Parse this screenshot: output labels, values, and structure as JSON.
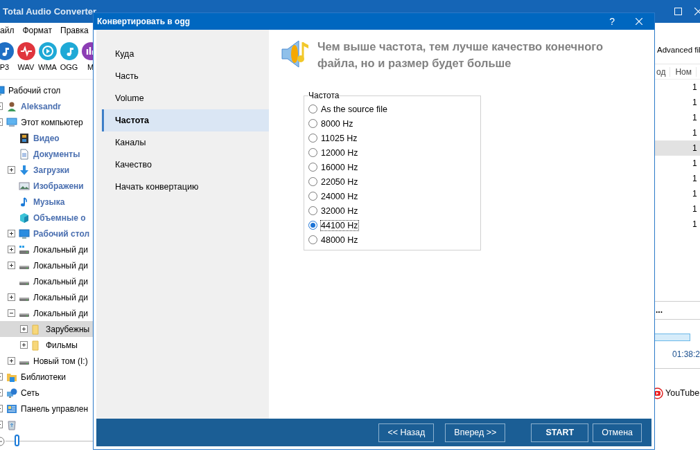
{
  "app": {
    "title": "Total Audio Converter",
    "menu": [
      "айл",
      "Формат",
      "Правка"
    ],
    "formats": [
      {
        "label": "P3",
        "color": "#1f6fc4",
        "kind": "note"
      },
      {
        "label": "WAV",
        "color": "#e0353d",
        "kind": "wave"
      },
      {
        "label": "WMA",
        "color": "#1fa9d6",
        "kind": "play"
      },
      {
        "label": "OGG",
        "color": "#1fa9d6",
        "kind": "note"
      },
      {
        "label": "M",
        "color": "#8c3db4",
        "kind": "bars"
      }
    ],
    "tree": [
      {
        "label": "Рабочий стол",
        "kind": "desktop",
        "bold": false,
        "selected": false,
        "expandable": false,
        "children": [
          {
            "label": "Aleksandr",
            "kind": "user",
            "bold": true,
            "selected": false,
            "expandable": true
          },
          {
            "label": "Этот компьютер",
            "kind": "computer",
            "bold": false,
            "selected": false,
            "expandable": true,
            "children": [
              {
                "label": "Видео",
                "kind": "video",
                "bold": true,
                "selected": false,
                "expandable": false
              },
              {
                "label": "Документы",
                "kind": "document",
                "bold": true,
                "selected": false,
                "expandable": false
              },
              {
                "label": "Загрузки",
                "kind": "download",
                "bold": true,
                "selected": false,
                "expandable": true,
                "expanded": false
              },
              {
                "label": "Изображени",
                "kind": "image",
                "bold": true,
                "selected": false,
                "expandable": false
              },
              {
                "label": "Музыка",
                "kind": "music",
                "bold": true,
                "selected": false,
                "expandable": false
              },
              {
                "label": "Объемные о",
                "kind": "cube",
                "bold": true,
                "selected": false,
                "expandable": false
              },
              {
                "label": "Рабочий стол",
                "kind": "desktop",
                "bold": true,
                "selected": false,
                "expandable": true,
                "expanded": false
              },
              {
                "label": "Локальный ди",
                "kind": "drive-win",
                "bold": false,
                "selected": false,
                "expandable": true,
                "expanded": false
              },
              {
                "label": "Локальный ди",
                "kind": "drive",
                "bold": false,
                "selected": false,
                "expandable": true,
                "expanded": false
              },
              {
                "label": "Локальный ди",
                "kind": "drive",
                "bold": false,
                "selected": false,
                "expandable": false
              },
              {
                "label": "Локальный ди",
                "kind": "drive",
                "bold": false,
                "selected": false,
                "expandable": true,
                "expanded": false
              },
              {
                "label": "Локальный ди",
                "kind": "drive",
                "bold": false,
                "selected": false,
                "expandable": true,
                "expanded": true,
                "children": [
                  {
                    "label": "Зарубежны",
                    "kind": "folder",
                    "bold": false,
                    "selected": true,
                    "expandable": true,
                    "expanded": false
                  },
                  {
                    "label": "Фильмы",
                    "kind": "folder",
                    "bold": false,
                    "selected": false,
                    "expandable": true,
                    "expanded": false
                  }
                ]
              },
              {
                "label": "Новый том (I:)",
                "kind": "drive",
                "bold": false,
                "selected": false,
                "expandable": true,
                "expanded": false
              }
            ]
          },
          {
            "label": "Библиотеки",
            "kind": "library",
            "bold": false,
            "selected": false,
            "expandable": true
          },
          {
            "label": "Сеть",
            "kind": "network",
            "bold": false,
            "selected": false,
            "expandable": true
          },
          {
            "label": "Панель управлен",
            "kind": "panel",
            "bold": false,
            "selected": false,
            "expandable": true
          },
          {
            "kind": "recycle",
            "bold": false,
            "selected": false,
            "expandable": true
          }
        ]
      }
    ],
    "right_panel": {
      "filter": "Advanced fil",
      "columns": [
        "од",
        "Ном"
      ],
      "rows": [
        {
          "value": "1",
          "selected": false
        },
        {
          "value": "1",
          "selected": false
        },
        {
          "value": "1",
          "selected": false
        },
        {
          "value": "1",
          "selected": false
        },
        {
          "value": "1",
          "selected": true
        },
        {
          "value": "1",
          "selected": false
        },
        {
          "value": "1",
          "selected": false
        },
        {
          "value": "1",
          "selected": false
        },
        {
          "value": "1",
          "selected": false
        },
        {
          "value": "1",
          "selected": false
        }
      ],
      "ellipsis": "...",
      "progress": {
        "level": 1
      },
      "time": "01:38:2",
      "youtube": "YouTube"
    }
  },
  "dialog": {
    "title": "Конвертировать в ogg",
    "help": "?",
    "nav": [
      {
        "label": "Куда",
        "selected": false
      },
      {
        "label": "Часть",
        "selected": false
      },
      {
        "label": "Volume",
        "selected": false
      },
      {
        "label": "Частота",
        "selected": true
      },
      {
        "label": "Каналы",
        "selected": false
      },
      {
        "label": "Качество",
        "selected": false
      },
      {
        "label": "Начать конвертацию",
        "selected": false
      }
    ],
    "heading": "Чем выше частота, тем лучше качество конечного файла, но и размер будет больше",
    "group": {
      "legend": "Частота",
      "options": [
        {
          "label": "As the source file",
          "selected": false
        },
        {
          "label": "8000 Hz",
          "selected": false
        },
        {
          "label": "11025 Hz",
          "selected": false
        },
        {
          "label": "12000 Hz",
          "selected": false
        },
        {
          "label": "16000 Hz",
          "selected": false
        },
        {
          "label": "22050 Hz",
          "selected": false
        },
        {
          "label": "24000 Hz",
          "selected": false
        },
        {
          "label": "32000 Hz",
          "selected": false
        },
        {
          "label": "44100 Hz",
          "selected": true
        },
        {
          "label": "48000 Hz",
          "selected": false
        }
      ]
    },
    "buttons": [
      {
        "label": "<< Назад",
        "kind": "normal"
      },
      {
        "label": "Вперед >>",
        "kind": "normal"
      },
      {
        "label": "START",
        "kind": "primary"
      },
      {
        "label": "Отмена",
        "kind": "normal"
      }
    ]
  }
}
